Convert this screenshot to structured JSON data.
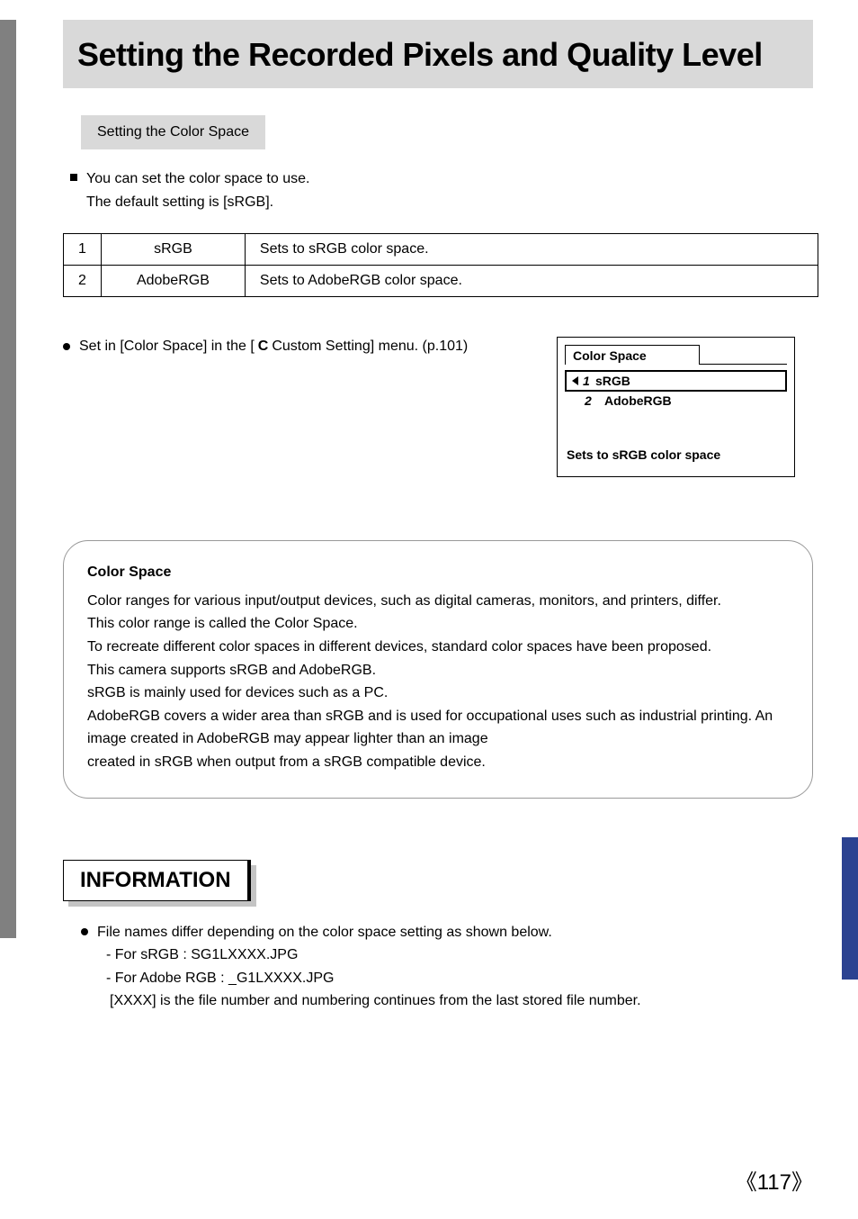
{
  "title": "Setting the Recorded Pixels and Quality Level",
  "subheading": "Setting the Color Space",
  "intro": {
    "line1": "You can set the color space to use.",
    "line2": "The default setting is [sRGB]."
  },
  "table": {
    "rows": [
      {
        "num": "1",
        "name": "sRGB",
        "desc": "Sets to sRGB color space."
      },
      {
        "num": "2",
        "name": "AdobeRGB",
        "desc": "Sets to AdobeRGB color space."
      }
    ]
  },
  "setin": {
    "pre": "Set in [Color Space] in the [",
    "icon": "C",
    "post": " Custom Setting] menu. (p.101)"
  },
  "lcd": {
    "title": "Color Space",
    "opt1_num": "1",
    "opt1_label": "sRGB",
    "opt2_num": "2",
    "opt2_label": "AdobeRGB",
    "message": "Sets to sRGB color space"
  },
  "infobox": {
    "title": "Color Space",
    "p1": "Color ranges for various input/output devices, such as digital cameras, monitors, and printers, differ.",
    "p2": "This color range is called the Color Space.",
    "p3": "To recreate different color spaces in different devices, standard color spaces have been proposed.",
    "p4": "This camera supports sRGB and AdobeRGB.",
    "p5": "sRGB is mainly used for devices such as a PC.",
    "p6": "AdobeRGB covers a wider area than sRGB and is used for occupational uses such as industrial printing. An image created in AdobeRGB may appear lighter than an image",
    "p7": "created in sRGB when output from a sRGB compatible device."
  },
  "information": {
    "header": "INFORMATION",
    "line1": "File names differ depending on the color space setting as shown below.",
    "line2": "- For sRGB : SG1LXXXX.JPG",
    "line3": "- For Adobe RGB : _G1LXXXX.JPG",
    "line4": "[XXXX] is the file number and numbering continues from the last stored file number."
  },
  "page_number": "117"
}
